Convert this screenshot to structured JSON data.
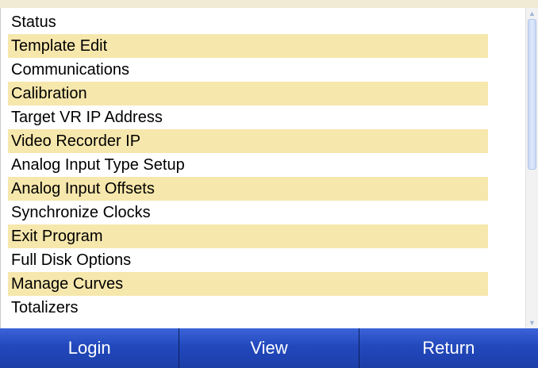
{
  "menu": {
    "items": [
      {
        "label": "Status",
        "highlighted": false
      },
      {
        "label": "Template Edit",
        "highlighted": true
      },
      {
        "label": "Communications",
        "highlighted": false
      },
      {
        "label": "Calibration",
        "highlighted": true
      },
      {
        "label": "Target VR IP Address",
        "highlighted": false
      },
      {
        "label": "Video Recorder IP",
        "highlighted": true
      },
      {
        "label": "Analog Input Type Setup",
        "highlighted": false
      },
      {
        "label": "Analog Input Offsets",
        "highlighted": true
      },
      {
        "label": "Synchronize Clocks",
        "highlighted": false
      },
      {
        "label": "Exit Program",
        "highlighted": true
      },
      {
        "label": "Full Disk Options",
        "highlighted": false
      },
      {
        "label": "Manage Curves",
        "highlighted": true
      },
      {
        "label": "Totalizers",
        "highlighted": false
      }
    ]
  },
  "scrollbar": {
    "up_icon": "chevron-up-icon",
    "down_icon": "chevron-down-icon"
  },
  "buttons": {
    "login": "Login",
    "view": "View",
    "return": "Return"
  },
  "colors": {
    "highlight_row": "#f6e7ac",
    "button_bar": "#1f43b0",
    "button_text": "#ffffff"
  }
}
